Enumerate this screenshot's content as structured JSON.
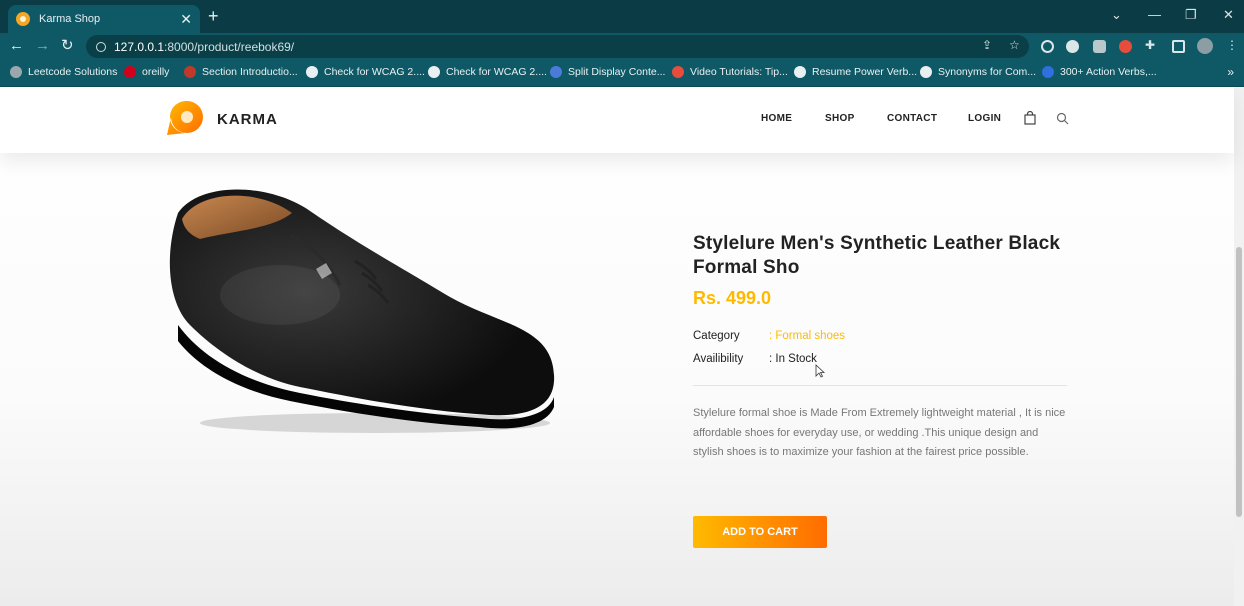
{
  "browser": {
    "tab_title": "Karma Shop",
    "tab_close": "✕",
    "new_tab": "+",
    "url_host": "127.0.0.1",
    "url_path": ":8000/product/reebok69/",
    "window_controls": [
      "⌄",
      "—",
      "❐",
      "✕"
    ],
    "bookmarks": [
      {
        "label": "Leetcode Solutions",
        "color": "#9aa7ad"
      },
      {
        "label": "oreilly",
        "color": "#d0021b"
      },
      {
        "label": "Section Introductio...",
        "color": "#c0392b"
      },
      {
        "label": "Check for WCAG 2....",
        "color": "#e8f0f2"
      },
      {
        "label": "Check for WCAG 2....",
        "color": "#e8f0f2"
      },
      {
        "label": "Split Display Conte...",
        "color": "#4a7bd8"
      },
      {
        "label": "Video Tutorials: Tip...",
        "color": "#e74c3c"
      },
      {
        "label": "Resume Power Verb...",
        "color": "#e8f0f2"
      },
      {
        "label": "Synonyms for Com...",
        "color": "#e8f0f2"
      },
      {
        "label": "300+ Action Verbs,...",
        "color": "#2f6fe0"
      }
    ],
    "bookmarks_more": "»"
  },
  "site": {
    "brand": "KARMA",
    "nav": [
      "HOME",
      "SHOP",
      "CONTACT",
      "LOGIN"
    ]
  },
  "product": {
    "title": "Stylelure Men's Synthetic Leather Black Formal Sho",
    "price": "Rs. 499.0",
    "category_label": "Category",
    "category_value": ": Formal shoes",
    "availability_label": "Availibility",
    "availability_value": ": In Stock",
    "description": "Stylelure formal shoe is Made From Extremely lightweight material , It is nice affordable shoes for everyday use, or wedding .This unique design and stylish shoes is to maximize your fashion at the fairest price possible.",
    "add_to_cart": "ADD TO CART"
  },
  "colors": {
    "browser_frame": "#0f5966",
    "accent": "#ffba00",
    "accent_end": "#ff6c00"
  }
}
